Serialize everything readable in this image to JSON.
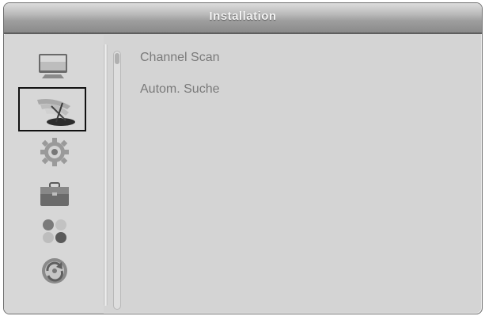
{
  "window": {
    "title": "Installation"
  },
  "sidebar": {
    "items": [
      {
        "icon": "monitor-icon",
        "selected": false
      },
      {
        "icon": "satellite-dish-icon",
        "selected": true
      },
      {
        "icon": "gear-icon",
        "selected": false
      },
      {
        "icon": "briefcase-icon",
        "selected": false
      },
      {
        "icon": "colored-dots-icon",
        "selected": false
      },
      {
        "icon": "refresh-disc-icon",
        "selected": false
      }
    ]
  },
  "menu": {
    "items": [
      {
        "label": "Channel Scan"
      },
      {
        "label": "Autom. Suche"
      }
    ]
  }
}
